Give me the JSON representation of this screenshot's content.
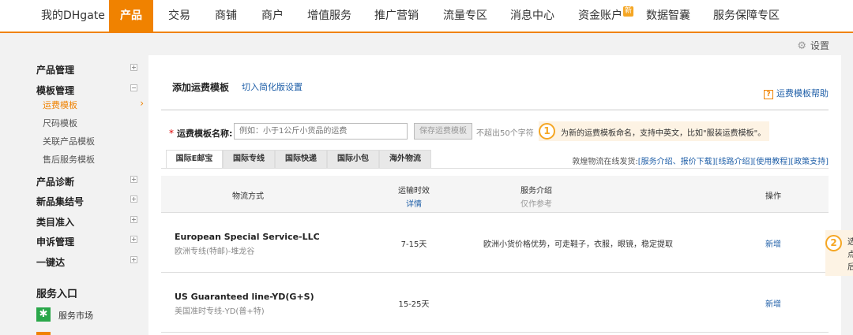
{
  "topnav": {
    "items": [
      "我的DHgate",
      "产品",
      "交易",
      "商铺",
      "商户",
      "增值服务",
      "推广营销",
      "流量专区",
      "消息中心",
      "资金账户",
      "数据智囊",
      "服务保障专区"
    ],
    "badge": "新"
  },
  "settings": {
    "label": "设置"
  },
  "sidebar": {
    "sections": [
      {
        "label": "产品管理",
        "toggle": "+"
      },
      {
        "label": "模板管理",
        "toggle": "−"
      },
      {
        "label": "产品诊断",
        "toggle": "+"
      },
      {
        "label": "新品集结号",
        "toggle": "+"
      },
      {
        "label": "类目准入",
        "toggle": "+"
      },
      {
        "label": "申诉管理",
        "toggle": "+"
      },
      {
        "label": "一键达",
        "toggle": "+"
      }
    ],
    "subitems": [
      "运费模板",
      "尺码模板",
      "关联产品模板",
      "售后服务模板"
    ],
    "active_arrow": "›",
    "service_entry": "服务入口",
    "service_market": "服务市场"
  },
  "main": {
    "title": "添加运费模板",
    "switch_link": "切入简化版设置",
    "help": "运费模板帮助",
    "help_icon": "?",
    "form": {
      "required_mark": "*",
      "label": "运费模板名称:",
      "placeholder": "例如：小于1公斤小货品的运费",
      "save_button": "保存运费模板",
      "limit": "不超出50个字符"
    },
    "tip1": {
      "num": "1",
      "text": "为新的运费模板命名，支持中英文，比如\"服装运费模板\"。"
    },
    "tabs": [
      "国际E邮宝",
      "国际专线",
      "国际快递",
      "国际小包",
      "海外物流"
    ],
    "tabs_note": {
      "prefix": "敦煌物流在线发货:",
      "links": [
        "[服务介绍、报价下载]",
        "[线路介绍]",
        "[使用教程]",
        "[政策支持]"
      ]
    },
    "table": {
      "headers": {
        "method": "物流方式",
        "time": "运输时效",
        "time_sub": "详情",
        "intro": "服务介绍",
        "intro_sub": "仅作参考",
        "op": "操作"
      },
      "rows": [
        {
          "name": "European Special Service-LLC",
          "sub": "欧洲专线(特邮)-堆龙谷",
          "time": "7-15天",
          "desc": "欧洲小货价格优势，可走鞋子，衣服，眼镜，稳定提取",
          "op": "新增"
        },
        {
          "name": "US Guaranteed line-YD(G+S)",
          "sub": "美国准时专线-YD(普+特)",
          "time": "15-25天",
          "desc": "",
          "op": "新增"
        }
      ]
    },
    "tip2": {
      "num": "2",
      "lines": [
        "选",
        "点",
        "后"
      ]
    }
  }
}
